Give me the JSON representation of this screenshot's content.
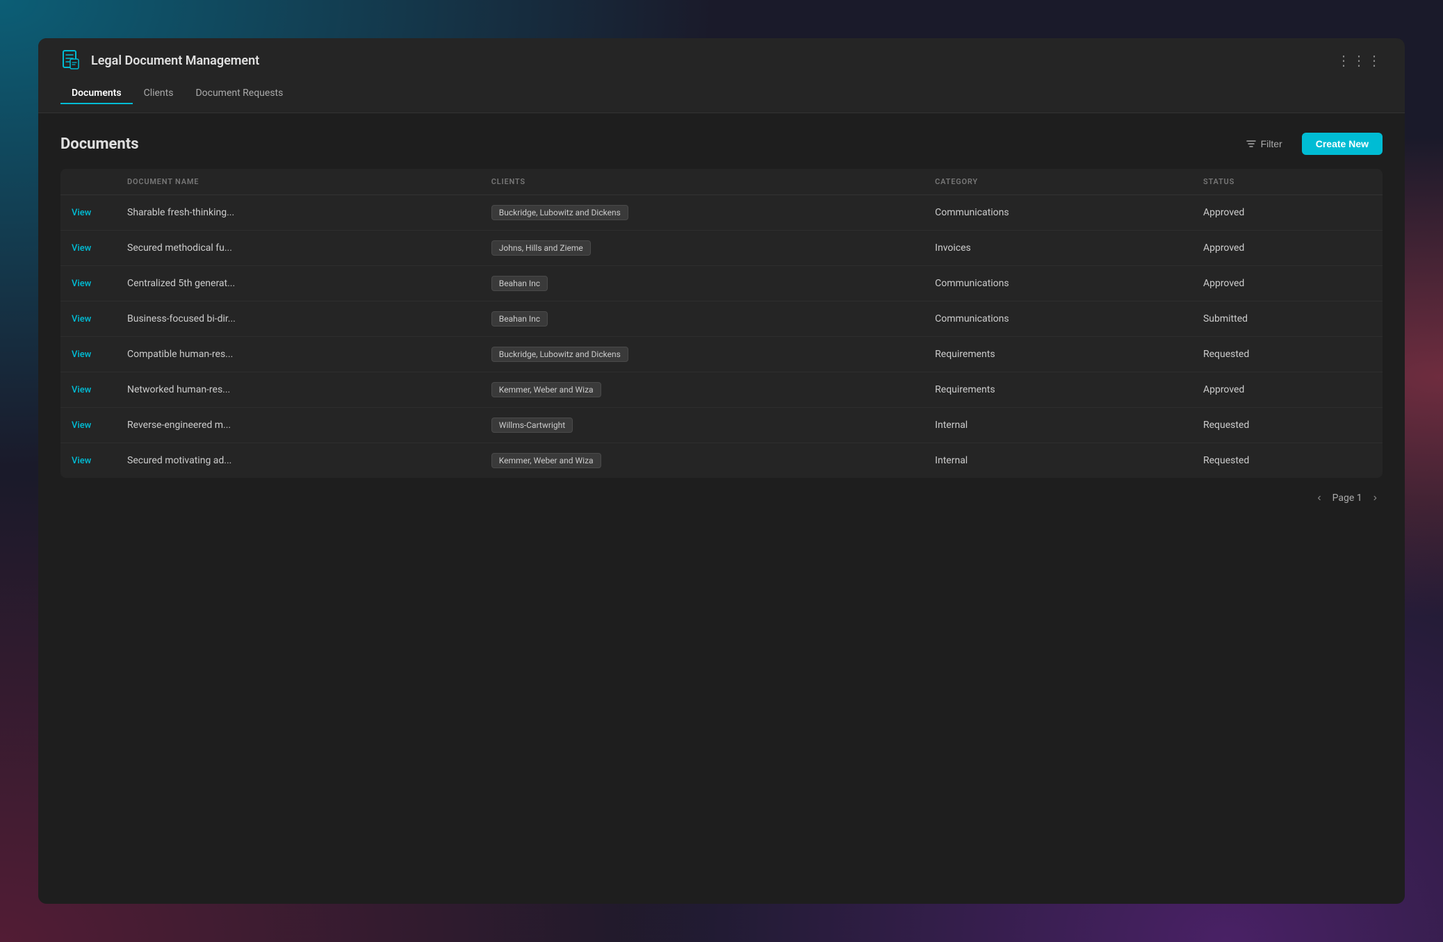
{
  "background": {
    "color": "#1a1a2a"
  },
  "app": {
    "title": "Legal Document Management",
    "icon_label": "document-icon"
  },
  "header": {
    "dots_label": "⋯",
    "nav": [
      {
        "label": "Documents",
        "active": true
      },
      {
        "label": "Clients",
        "active": false
      },
      {
        "label": "Document Requests",
        "active": false
      }
    ]
  },
  "section": {
    "title": "Documents",
    "filter_label": "Filter",
    "create_new_label": "Create New"
  },
  "table": {
    "columns": [
      "",
      "DOCUMENT NAME",
      "CLIENTS",
      "CATEGORY",
      "STATUS"
    ],
    "rows": [
      {
        "view": "View",
        "name": "Sharable fresh-thinking...",
        "client": "Buckridge, Lubowitz and Dickens",
        "category": "Communications",
        "status": "Approved"
      },
      {
        "view": "View",
        "name": "Secured methodical fu...",
        "client": "Johns, Hills and Zieme",
        "category": "Invoices",
        "status": "Approved"
      },
      {
        "view": "View",
        "name": "Centralized 5th generat...",
        "client": "Beahan Inc",
        "category": "Communications",
        "status": "Approved"
      },
      {
        "view": "View",
        "name": "Business-focused bi-dir...",
        "client": "Beahan Inc",
        "category": "Communications",
        "status": "Submitted"
      },
      {
        "view": "View",
        "name": "Compatible human-res...",
        "client": "Buckridge, Lubowitz and Dickens",
        "category": "Requirements",
        "status": "Requested"
      },
      {
        "view": "View",
        "name": "Networked human-res...",
        "client": "Kemmer, Weber and Wiza",
        "category": "Requirements",
        "status": "Approved"
      },
      {
        "view": "View",
        "name": "Reverse-engineered m...",
        "client": "Willms-Cartwright",
        "category": "Internal",
        "status": "Requested"
      },
      {
        "view": "View",
        "name": "Secured motivating ad...",
        "client": "Kemmer, Weber and Wiza",
        "category": "Internal",
        "status": "Requested"
      }
    ]
  },
  "pagination": {
    "prev_label": "‹",
    "next_label": "›",
    "page_label": "Page 1"
  }
}
